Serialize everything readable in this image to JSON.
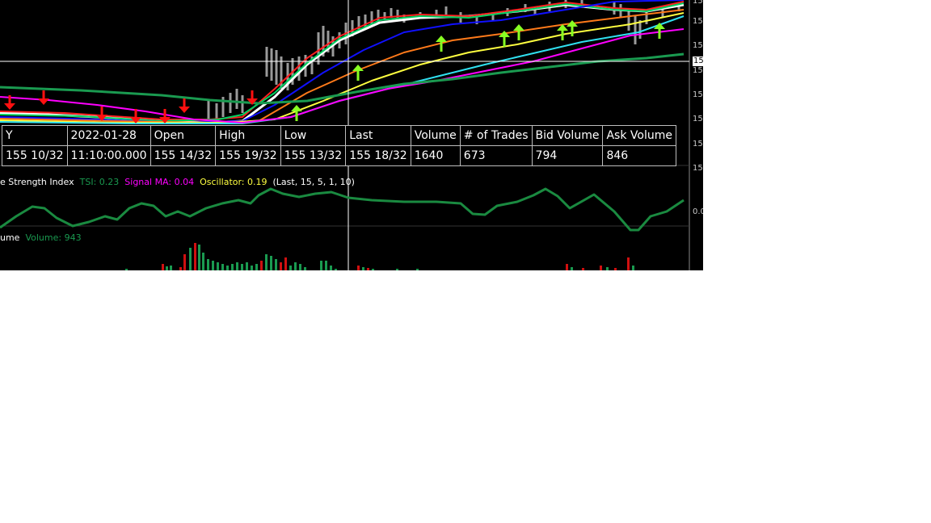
{
  "colors": {
    "background": "#000000",
    "ema_white": "#ffffff",
    "ema_red": "#ff2020",
    "ema_green": "#00d060",
    "ema_blue": "#1010ff",
    "ema_orange": "#ff7a1a",
    "ema_yellow": "#ffff40",
    "ema_cyan": "#30e0f0",
    "ema_magenta": "#ff00ff",
    "ema_darkgreen": "#1a9a50",
    "arrow_up": "#88ff22",
    "arrow_down": "#ff1010",
    "tsi_line": "#1a8a40",
    "vol_up": "#1a9a50",
    "vol_down": "#d01010"
  },
  "price_axis": {
    "tick_labels": [
      "15",
      "15",
      "15",
      "15",
      "15",
      "15",
      "15",
      "15",
      "15"
    ],
    "highlighted_label": "15"
  },
  "data_window": {
    "headers": [
      "Y",
      "2022-01-28",
      "Open",
      "High",
      "Low",
      "Last",
      "Volume",
      "# of Trades",
      "Bid Volume",
      "Ask Volume"
    ],
    "values": [
      "155 10/32",
      "11:10:00.000",
      "155 14/32",
      "155 19/32",
      "155 13/32",
      "155 18/32",
      "1640",
      "673",
      "794",
      "846"
    ]
  },
  "tsi_panel": {
    "study_name": "e Strength Index",
    "tsi": "TSI: 0.23",
    "signal": "Signal MA: 0.04",
    "oscillator": "Oscillator: 0.19",
    "params": "(Last, 15, 5, 1, 10)",
    "zero_label": "0.0"
  },
  "volume_panel": {
    "study_name": "ume",
    "volume": "Volume: 943"
  }
}
